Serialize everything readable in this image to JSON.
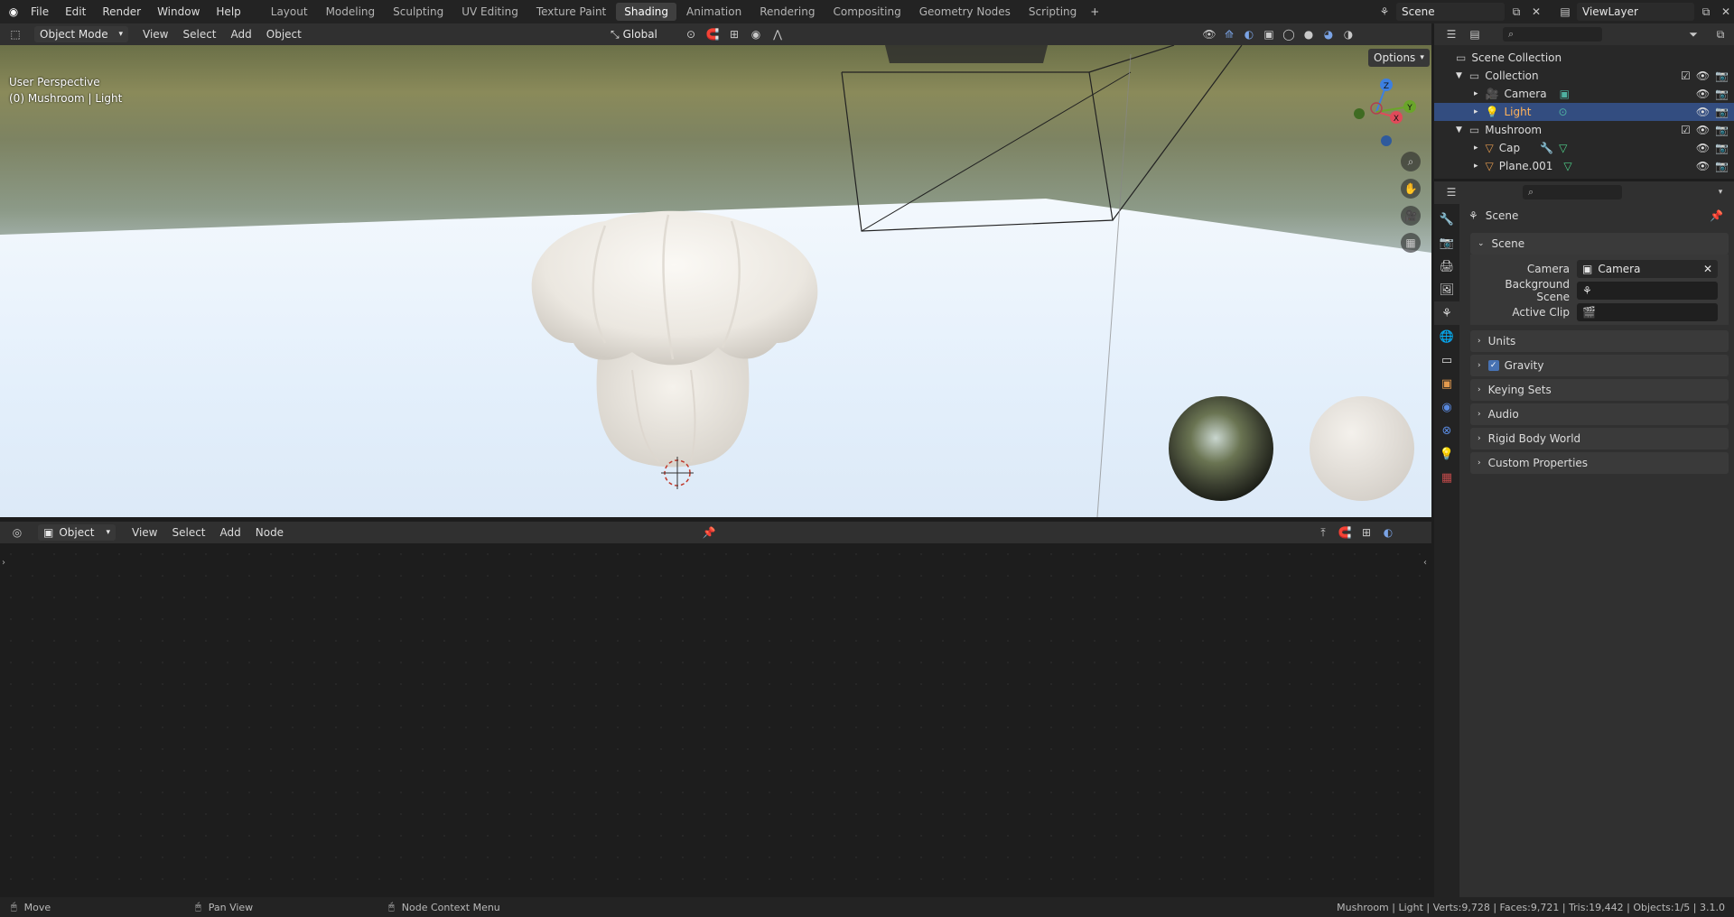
{
  "topbar": {
    "menus": [
      "File",
      "Edit",
      "Render",
      "Window",
      "Help"
    ],
    "workspaces": [
      "Layout",
      "Modeling",
      "Sculpting",
      "UV Editing",
      "Texture Paint",
      "Shading",
      "Animation",
      "Rendering",
      "Compositing",
      "Geometry Nodes",
      "Scripting"
    ],
    "active_workspace": "Shading",
    "scene_name": "Scene",
    "view_layer": "ViewLayer"
  },
  "viewport_header": {
    "mode": "Object Mode",
    "menus": [
      "View",
      "Select",
      "Add",
      "Object"
    ],
    "transform_orientation": "Global",
    "options_label": "Options"
  },
  "viewport": {
    "perspective_label": "User Perspective",
    "object_label": "(0) Mushroom | Light",
    "gizmo_axes": {
      "x": "X",
      "y": "Y",
      "z": "Z"
    }
  },
  "node_editor_header": {
    "type": "Object",
    "menus": [
      "View",
      "Select",
      "Add",
      "Node"
    ]
  },
  "outliner": {
    "root": "Scene Collection",
    "items": [
      {
        "label": "Collection",
        "indent": 1,
        "type": "collection"
      },
      {
        "label": "Camera",
        "indent": 2,
        "type": "camera"
      },
      {
        "label": "Light",
        "indent": 2,
        "type": "light",
        "selected": true
      },
      {
        "label": "Mushroom",
        "indent": 1,
        "type": "collection"
      },
      {
        "label": "Cap",
        "indent": 2,
        "type": "mesh"
      },
      {
        "label": "Plane.001",
        "indent": 2,
        "type": "mesh"
      }
    ]
  },
  "properties": {
    "context": "Scene",
    "section": "Scene",
    "fields": [
      {
        "label": "Camera",
        "value": "Camera"
      },
      {
        "label": "Background Scene",
        "value": ""
      },
      {
        "label": "Active Clip",
        "value": ""
      }
    ],
    "panels": [
      "Units",
      "Gravity",
      "Keying Sets",
      "Audio",
      "Rigid Body World",
      "Custom Properties"
    ],
    "gravity_checked": true
  },
  "statusbar": {
    "hints": [
      "Move",
      "Pan View",
      "Node Context Menu"
    ],
    "stats": "Mushroom | Light | Verts:9,728 | Faces:9,721 | Tris:19,442 | Objects:1/5 | 3.1.0"
  },
  "colors": {
    "accent": "#334d80",
    "active_tab": "#3f3f3f",
    "bg": "#1d1d1d"
  }
}
